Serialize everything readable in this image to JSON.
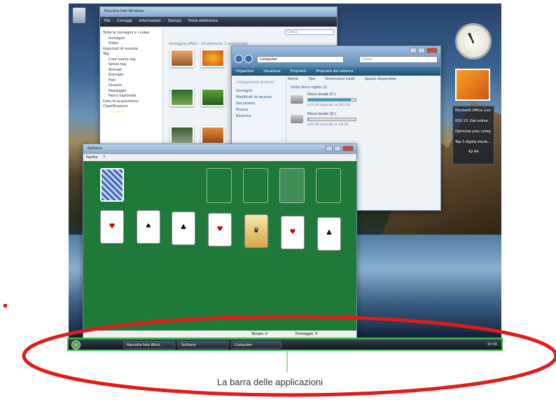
{
  "gallery": {
    "title": "Raccolta foto Windows",
    "toolbar": [
      "File",
      "Correggi",
      "Informazioni",
      "Stampa",
      "Posta elettronica"
    ],
    "nav": [
      "Tutte le immagini e i video",
      "Immagini",
      "Video",
      "Importati di recente",
      "Tag",
      "Crea nuovo tag",
      "Senza tag",
      "Animali",
      "Esempio",
      "Fiori",
      "Oceano",
      "Paesaggio",
      "Parco nazionale",
      "Data di acquisizione",
      "Classificazioni"
    ],
    "header": "Immagine (PNG) - 15 elementi, 1 selezionato",
    "search_placeholder": "Cerca"
  },
  "explorer": {
    "address": "Computer",
    "search_placeholder": "Cerca",
    "toolbar": [
      "Organizza",
      "Visualizza",
      "Proprietà",
      "Proprietà del sistema"
    ],
    "favorites_title": "Collegamenti preferiti",
    "favorites": [
      "Immagini",
      "Modificati di recente",
      "Documenti",
      "Musica",
      "Ricerche"
    ],
    "columns": [
      "Nome",
      "Tipo",
      "Dimensioni totali",
      "Spazio disponibile"
    ],
    "group": "Unità disco rigido (2)",
    "drives": [
      {
        "name": "Disco locale (C:)",
        "info": "6,01 GB disponibili su 58,5 GB",
        "fill": 0.9
      },
      {
        "name": "Disco locale (D:)",
        "info": "9,65 GB disponibili su 9,8 GB",
        "fill": 0.02
      }
    ]
  },
  "solitaire": {
    "title": "Solitario",
    "menu": [
      "Partita",
      "?"
    ],
    "time": "Tempo: 0",
    "score": "Punteggio: 0"
  },
  "gadgets": {
    "feeds": [
      "Microsoft Office Live",
      "RSS 10: Get online",
      "Optimize your comp...",
      "Top 5 digital storie..."
    ],
    "feed_nav": "42-44"
  },
  "taskbar": {
    "buttons": [
      "Raccolta foto Wind...",
      "Solitario",
      "Computer"
    ],
    "clock": "10:30"
  },
  "caption": "La barra delle applicazioni",
  "colors": {
    "ellipse": "#e11a1a",
    "taskbar_highlight": "#34c23a",
    "felt": "#1f7a3a"
  }
}
